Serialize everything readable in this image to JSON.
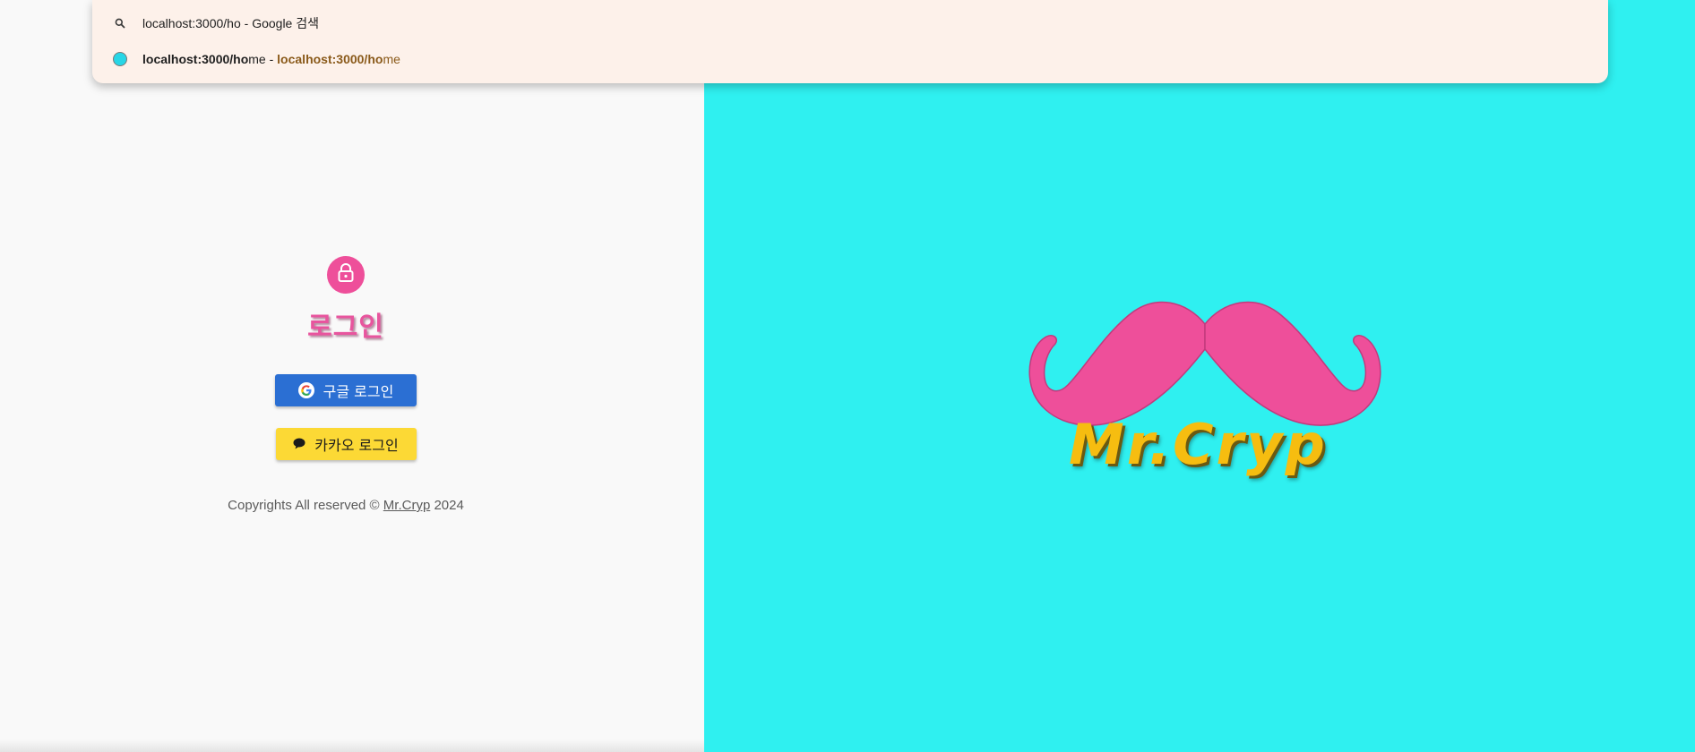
{
  "omnibox": {
    "suggestions": [
      {
        "icon": "search-icon",
        "text": "localhost:3000/ho - Google 검색"
      },
      {
        "icon": "site-favicon-icon",
        "url_bold": "localhost:3000/ho",
        "url_rest": "me",
        "separator": " - ",
        "title_bold": "localhost:3000/ho",
        "title_rest": "me"
      }
    ]
  },
  "login": {
    "icon": "lock-icon",
    "title": "로그인",
    "google_button": {
      "icon": "google-icon",
      "label": "구글 로그인"
    },
    "kakao_button": {
      "icon": "chat-bubble-icon",
      "label": "카카오 로그인"
    },
    "copyright": {
      "prefix": "Copyrights All reserved ©",
      "link": "Mr.Cryp",
      "year": "2024"
    }
  },
  "brand": {
    "logo": "mustache-icon",
    "name": "Mr.Cryp"
  },
  "colors": {
    "left_background": "#f9f9f9",
    "right_background": "#2ff0f0",
    "accent_pink": "#ee4f9a",
    "google_blue": "#2b6fd3",
    "kakao_yellow": "#fcd935",
    "logo_gold": "#f6bd10",
    "omnibox_background": "#fdf1ea"
  }
}
